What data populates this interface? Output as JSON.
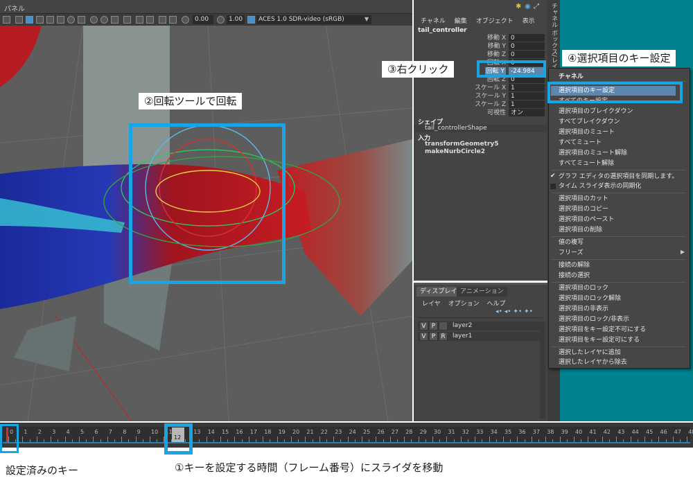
{
  "viewport": {
    "panel_menu": "パネル",
    "toolbar": {
      "exposure": "0.00",
      "gamma": "1.00",
      "color_space": "ACES 1.0 SDR-video (sRGB)"
    }
  },
  "channel_box": {
    "menus": [
      "チャネル",
      "編集",
      "オブジェクト",
      "表示"
    ],
    "object_name": "tail_controller",
    "attributes": [
      {
        "label": "移動 X",
        "value": "0"
      },
      {
        "label": "移動 Y",
        "value": "0"
      },
      {
        "label": "移動 Z",
        "value": "0"
      },
      {
        "label": "回転 X",
        "value": "0"
      },
      {
        "label": "回転 Y",
        "value": "-24.984"
      },
      {
        "label": "回転 Z",
        "value": "0"
      },
      {
        "label": "スケール X",
        "value": "1"
      },
      {
        "label": "スケール Y",
        "value": "1"
      },
      {
        "label": "スケール Z",
        "value": "1"
      },
      {
        "label": "可視性",
        "value": "オン"
      }
    ],
    "shapes_header": "シェイプ",
    "shape_name": "tail_controllerShape",
    "inputs_header": "入力",
    "inputs": [
      "transformGeometry5",
      "makeNurbCircle2"
    ]
  },
  "side_tab": "チャネル ボックス/レイヤ エ",
  "layer_editor": {
    "tabs": [
      "ディスプレイ",
      "アニメーション"
    ],
    "menus": [
      "レイヤ",
      "オプション",
      "ヘルプ"
    ],
    "layers": [
      {
        "v": "V",
        "p": "P",
        "r": "",
        "name": "layer2"
      },
      {
        "v": "V",
        "p": "P",
        "r": "R",
        "name": "layer1"
      }
    ]
  },
  "context_menu": {
    "header": "チャネル",
    "items": [
      "選択項目のキー設定",
      "すべてのキー設定",
      "選択項目のブレイクダウン",
      "すべてブレイクダウン",
      "選択項目のミュート",
      "すべてミュート",
      "選択項目のミュート解除",
      "すべてミュート解除",
      "グラフ エディタの選択項目を同期します。",
      "タイム スライダ表示の同期化",
      "選択項目のカット",
      "選択項目のコピー",
      "選択項目のペースト",
      "選択項目の削除",
      "値の複写",
      "フリーズ",
      "接続の解除",
      "接続の選択",
      "選択項目のロック",
      "選択項目のロック解除",
      "選択項目の非表示",
      "選択項目のロック/非表示",
      "選択項目をキー設定不可にする",
      "選択項目をキー設定可にする",
      "選択したレイヤに追加",
      "選択したレイヤから除去"
    ]
  },
  "timeline": {
    "frames": [
      "0",
      "1",
      "2",
      "3",
      "4",
      "5",
      "6",
      "7",
      "8",
      "9",
      "10",
      "11",
      "12",
      "13",
      "14",
      "15",
      "16",
      "17",
      "18",
      "19",
      "20",
      "21",
      "22",
      "23",
      "24",
      "25",
      "26",
      "27",
      "28",
      "29",
      "30",
      "31",
      "32",
      "33",
      "34",
      "35",
      "36",
      "37",
      "38",
      "39",
      "40",
      "41",
      "42",
      "43",
      "44",
      "45",
      "46",
      "47",
      "48"
    ],
    "current_frame": "12"
  },
  "annotations": {
    "step1": "①キーを設定する時間（フレーム番号）にスライダを移動",
    "step2": "②回転ツールで回転",
    "step3": "③右クリック",
    "step4": "④選択項目のキー設定",
    "keyed": "設定済みのキー"
  },
  "colors": {
    "highlight_box": "#19a4e3",
    "teal_background": "#00838e",
    "menu_highlight": "#5c87b0"
  }
}
